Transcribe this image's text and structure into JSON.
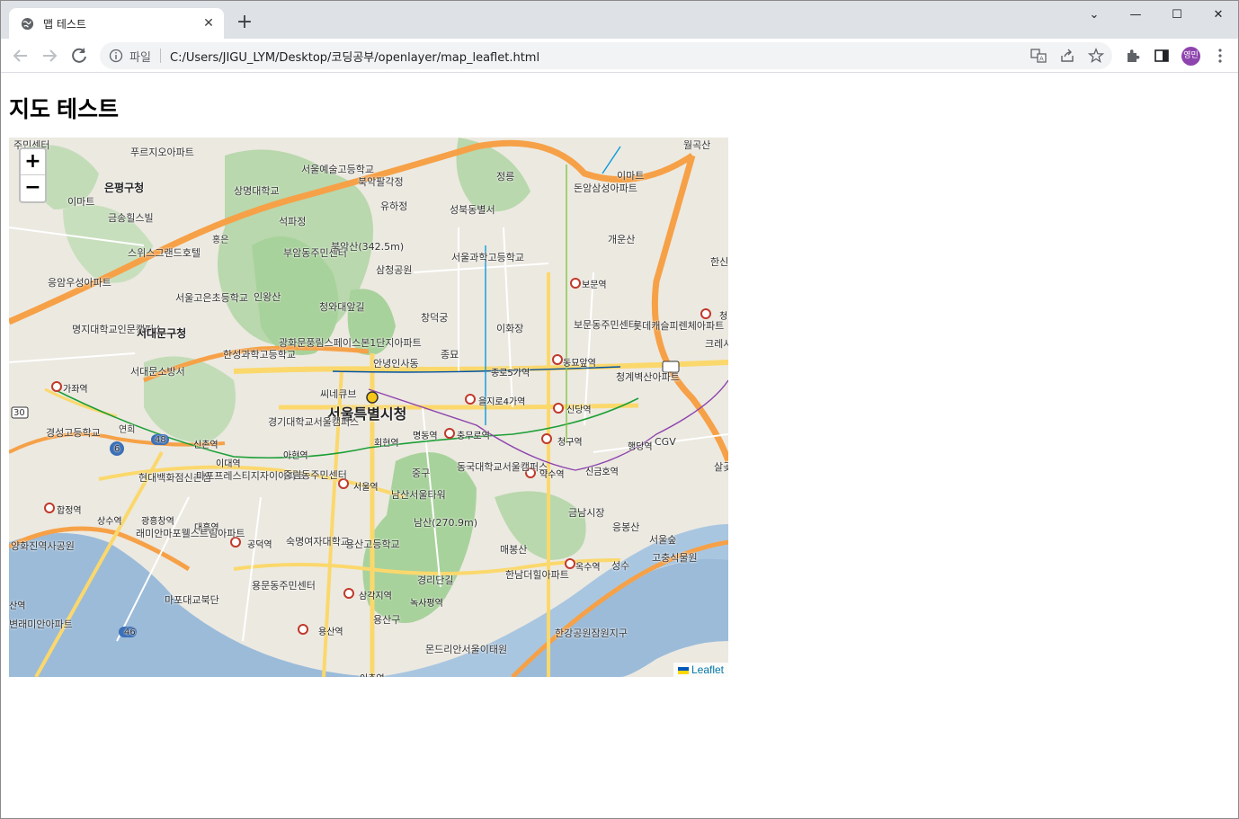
{
  "browser": {
    "tab_title": "맵 테스트",
    "tab_close": "✕",
    "new_tab": "+",
    "window_controls": {
      "chevron": "⌄",
      "minimize": "—",
      "maximize": "☐",
      "close": "✕"
    },
    "address": {
      "scheme_label": "파일",
      "url": "C:/Users/JIGU_LYM/Desktop/코딩공부/openlayer/map_leaflet.html"
    },
    "profile_initials": "영민",
    "icons": [
      "back-arrow-icon",
      "forward-arrow-icon",
      "reload-icon",
      "info-icon",
      "translate-icon",
      "share-icon",
      "star-icon",
      "extensions-icon",
      "side-panel-icon",
      "kebab-menu-icon"
    ]
  },
  "page": {
    "heading": "지도 테스트"
  },
  "map": {
    "zoom_in": "+",
    "zoom_out": "−",
    "attribution": "Leaflet",
    "colors": {
      "park": "#a8d29b",
      "river": "#9bbbd9",
      "highway": "#f6a147",
      "road": "#fbd86c",
      "land": "#ece9e1"
    },
    "labels": [
      {
        "t": "주민센터",
        "c": "md"
      },
      {
        "t": "푸르지오아파트",
        "c": "md"
      },
      {
        "t": "은평구청",
        "c": "lg"
      },
      {
        "t": "이마트",
        "c": "md"
      },
      {
        "t": "금송힐스빌",
        "c": "md"
      },
      {
        "t": "홍은",
        "c": "sm"
      },
      {
        "t": "스위스그랜드호텔",
        "c": "md"
      },
      {
        "t": "응암우성아파트",
        "c": "md"
      },
      {
        "t": "명지대학교인문캠퍼스",
        "c": "md"
      },
      {
        "t": "서대문구청",
        "c": "lg"
      },
      {
        "t": "서대문소방서",
        "c": "md"
      },
      {
        "t": "서울고은초등학교",
        "c": "md"
      },
      {
        "t": "한성과학고등학교",
        "c": "md"
      },
      {
        "t": "서울예술고등학교",
        "c": "md"
      },
      {
        "t": "상명대학교",
        "c": "md"
      },
      {
        "t": "석파정",
        "c": "md"
      },
      {
        "t": "부암동주민센터",
        "c": "md"
      },
      {
        "t": "북악산(342.5m)",
        "c": "md"
      },
      {
        "t": "인왕산",
        "c": "md"
      },
      {
        "t": "북악팔각정",
        "c": "md"
      },
      {
        "t": "유하정",
        "c": "md"
      },
      {
        "t": "삼청공원",
        "c": "md"
      },
      {
        "t": "청와대앞길",
        "c": "md"
      },
      {
        "t": "광화문풍림스페이스본1단지아파트",
        "c": "md"
      },
      {
        "t": "창덕궁",
        "c": "md"
      },
      {
        "t": "종묘",
        "c": "md"
      },
      {
        "t": "안녕인사동",
        "c": "md"
      },
      {
        "t": "씨네큐브",
        "c": "md"
      },
      {
        "t": "서울특별시청",
        "c": "xl"
      },
      {
        "t": "성북동별서",
        "c": "md"
      },
      {
        "t": "서울과학고등학교",
        "c": "md"
      },
      {
        "t": "정릉",
        "c": "md"
      },
      {
        "t": "돈암삼성아파트",
        "c": "md"
      },
      {
        "t": "이마트",
        "c": "md"
      },
      {
        "t": "개운산",
        "c": "md"
      },
      {
        "t": "보문역",
        "c": "st"
      },
      {
        "t": "이화장",
        "c": "md"
      },
      {
        "t": "보문동주민센터",
        "c": "md"
      },
      {
        "t": "롯데캐슬피렌체아파트",
        "c": "md"
      },
      {
        "t": "동묘앞역",
        "c": "st"
      },
      {
        "t": "청계벽산아파트",
        "c": "md"
      },
      {
        "t": "종로5가역",
        "c": "st"
      },
      {
        "t": "을지로4가역",
        "c": "st"
      },
      {
        "t": "신당역",
        "c": "st"
      },
      {
        "t": "청구역",
        "c": "st"
      },
      {
        "t": "CGV",
        "c": "md"
      },
      {
        "t": "충무로역",
        "c": "st"
      },
      {
        "t": "명동역",
        "c": "st"
      },
      {
        "t": "회현역",
        "c": "st"
      },
      {
        "t": "가좌역",
        "c": "st"
      },
      {
        "t": "경성고등학교",
        "c": "md"
      },
      {
        "t": "연희",
        "c": "sm"
      },
      {
        "t": "경기대학교서울캠퍼스",
        "c": "md"
      },
      {
        "t": "신촌역",
        "c": "st"
      },
      {
        "t": "이대역",
        "c": "st"
      },
      {
        "t": "아현역",
        "c": "st"
      },
      {
        "t": "현대백화점신촌점",
        "c": "md"
      },
      {
        "t": "마포프레스티지자이아파트",
        "c": "md"
      },
      {
        "t": "중림동주민센터",
        "c": "md"
      },
      {
        "t": "서울역",
        "c": "st"
      },
      {
        "t": "중구",
        "c": "md"
      },
      {
        "t": "동국대학교서울캠퍼스",
        "c": "md"
      },
      {
        "t": "남산서울타워",
        "c": "md"
      },
      {
        "t": "약수역",
        "c": "st"
      },
      {
        "t": "신금호역",
        "c": "st"
      },
      {
        "t": "행당역",
        "c": "st"
      },
      {
        "t": "금남시장",
        "c": "md"
      },
      {
        "t": "남산(270.9m)",
        "c": "md"
      },
      {
        "t": "합정역",
        "c": "st"
      },
      {
        "t": "상수역",
        "c": "st"
      },
      {
        "t": "광흥창역",
        "c": "st"
      },
      {
        "t": "대흥역",
        "c": "st"
      },
      {
        "t": "래미안마포웰스트림아파트",
        "c": "md"
      },
      {
        "t": "숙명여자대학교",
        "c": "md"
      },
      {
        "t": "용산고등학교",
        "c": "md"
      },
      {
        "t": "매봉산",
        "c": "md"
      },
      {
        "t": "응봉산",
        "c": "md"
      },
      {
        "t": "서울숲",
        "c": "md"
      },
      {
        "t": "고충식물원",
        "c": "md"
      },
      {
        "t": "공덕역",
        "c": "st"
      },
      {
        "t": "양화진역사공원",
        "c": "md"
      },
      {
        "t": "경리단길",
        "c": "md"
      },
      {
        "t": "한남더힐아파트",
        "c": "md"
      },
      {
        "t": "옥수역",
        "c": "st"
      },
      {
        "t": "성수",
        "c": "md"
      },
      {
        "t": "용문동주민센터",
        "c": "md"
      },
      {
        "t": "마포대교북단",
        "c": "md"
      },
      {
        "t": "삼각지역",
        "c": "st"
      },
      {
        "t": "녹사평역",
        "c": "st"
      },
      {
        "t": "용산구",
        "c": "md"
      },
      {
        "t": "산역",
        "c": "st"
      },
      {
        "t": "변래미안아파트",
        "c": "md"
      },
      {
        "t": "용산역",
        "c": "st"
      },
      {
        "t": "몬드리안서울이태원",
        "c": "md"
      },
      {
        "t": "한강공원잠원지구",
        "c": "md"
      },
      {
        "t": "이촌역",
        "c": "st"
      },
      {
        "t": "한신아",
        "c": "md"
      },
      {
        "t": "청량",
        "c": "st"
      },
      {
        "t": "크레셔",
        "c": "md"
      },
      {
        "t": "살곶체육",
        "c": "md"
      },
      {
        "t": "월곡산",
        "c": "md"
      },
      {
        "t": "30",
        "c": "sm"
      },
      {
        "t": "48",
        "c": "sm"
      },
      {
        "t": "6",
        "c": "sm"
      },
      {
        "t": "46",
        "c": "sm"
      }
    ]
  }
}
